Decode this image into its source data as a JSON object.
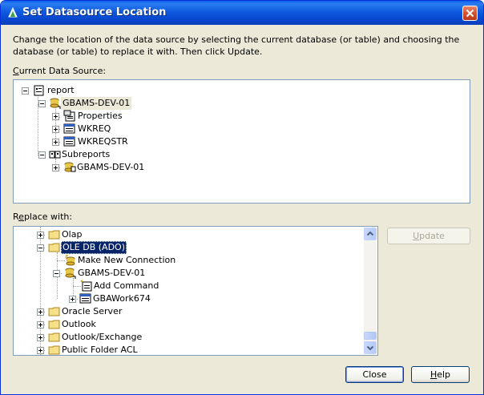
{
  "window": {
    "title": "Set Datasource Location",
    "close_label": "Close window"
  },
  "description": "Change the location of the data source by selecting the current database (or table) and choosing the database (or table) to replace it with.  Then click Update.",
  "current_data_source": {
    "label_access": "C",
    "label_rest": "urrent Data Source:",
    "tree": {
      "root": "report",
      "connection": "GBAMS-DEV-01",
      "properties": "Properties",
      "table1": "WKREQ",
      "table2": "WKREQSTR",
      "subreports": "Subreports",
      "sub_connection": "GBAMS-DEV-01"
    }
  },
  "replace_with": {
    "label_pre": "R",
    "label_access": "e",
    "label_rest": "place with:",
    "tree": {
      "olap": "Olap",
      "oledb": "OLE DB (ADO)",
      "make_new": "Make New Connection",
      "connection": "GBAMS-DEV-01",
      "add_command": "Add Command",
      "gbawork": "GBAWork674",
      "oracle": "Oracle Server",
      "outlook": "Outlook",
      "outlook_exchange": "Outlook/Exchange",
      "public_folder": "Public Folder ACL"
    }
  },
  "buttons": {
    "update_access": "U",
    "update_rest": "pdate",
    "close": "Close",
    "help_access": "H",
    "help_rest": "elp"
  },
  "colors": {
    "titlebar": "#0a61e8",
    "selection": "#0a246a",
    "dialog_bg": "#ece9d8"
  }
}
